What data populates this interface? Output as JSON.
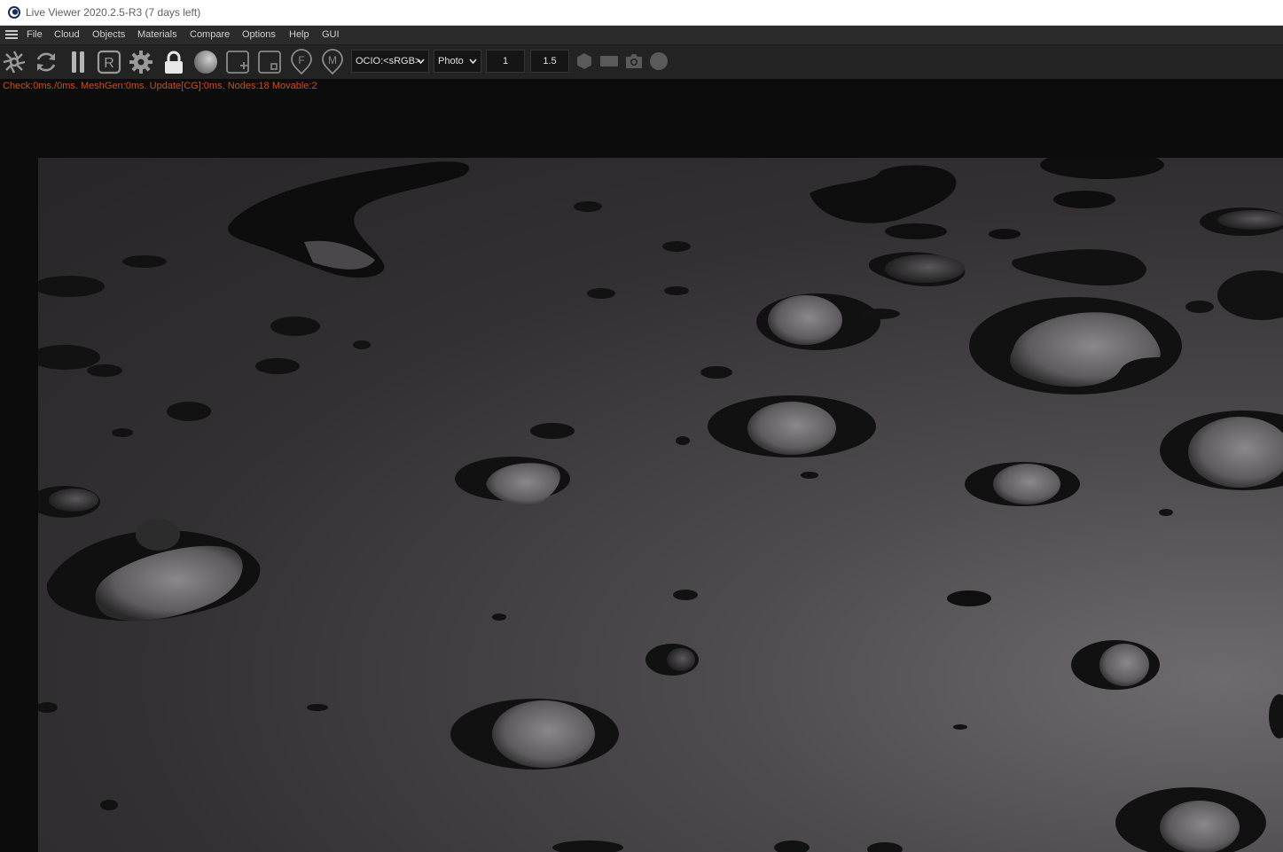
{
  "window": {
    "title": "Live Viewer 2020.2.5-R3 (7 days left)",
    "app_icon": "cinema4d-icon"
  },
  "menu": {
    "items": [
      "File",
      "Cloud",
      "Objects",
      "Materials",
      "Compare",
      "Options",
      "Help",
      "GUI"
    ]
  },
  "toolbar": {
    "icons": [
      "aperture-icon",
      "refresh-icon",
      "pause-icon",
      "r-icon",
      "gear-icon",
      "lock-icon",
      "sphere-icon",
      "add-region-icon",
      "region-icon",
      "f-pin-icon",
      "m-pin-icon"
    ],
    "ocio_value": "OCIO:<sRGB>",
    "tonemap_value": "Photo",
    "field_1": "1",
    "field_2": "1.5",
    "right_icons": [
      "hexagon-icon",
      "rectangle-icon",
      "camera-icon",
      "circle-icon"
    ]
  },
  "status": {
    "text": "Check:0ms./0ms. MeshGen:0ms. Update[CG]:0ms. Nodes:18 Movable:2",
    "color": "#c8501e"
  },
  "viewport": {
    "content": "rendered-water-droplets-image"
  }
}
